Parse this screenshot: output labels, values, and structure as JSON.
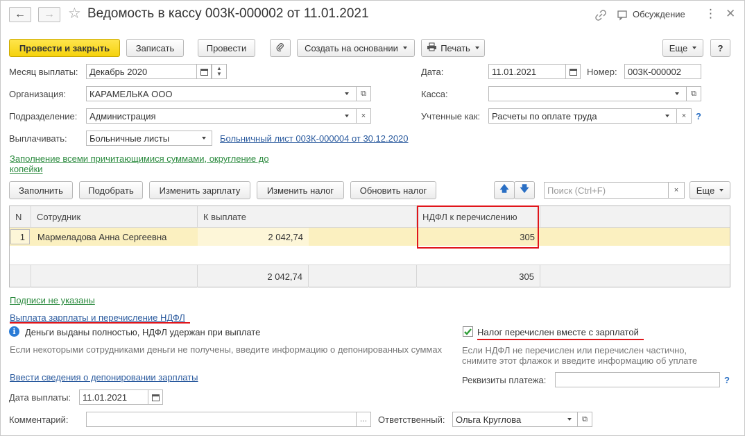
{
  "header": {
    "title": "Ведомость в кассу 003К-000002 от 11.01.2021",
    "discussion_label": "Обсуждение"
  },
  "toolbar": {
    "post_close_label": "Провести и закрыть",
    "save_label": "Записать",
    "post_label": "Провести",
    "create_based_label": "Создать на основании",
    "print_label": "Печать",
    "more_label": "Еще",
    "help_label": "?"
  },
  "form": {
    "month_label": "Месяц выплаты:",
    "month_value": "Декабрь 2020",
    "date_label": "Дата:",
    "date_value": "11.01.2021",
    "number_label": "Номер:",
    "number_value": "003К-000002",
    "org_label": "Организация:",
    "org_value": "КАРАМЕЛЬКА ООО",
    "cash_label": "Касса:",
    "cash_value": "",
    "dept_label": "Подразделение:",
    "dept_value": "Администрация",
    "account_label": "Учтенные как:",
    "account_value": "Расчеты по оплате труда",
    "pay_label": "Выплачивать:",
    "pay_value": "Больничные листы",
    "sick_link": "Больничный лист 003К-000004 от 30.12.2020",
    "fill_link_line1": "Заполнение всеми причитающимися суммами, округление до",
    "fill_link_line2": "копейки",
    "help_q": "?"
  },
  "table_toolbar": {
    "fill_label": "Заполнить",
    "pick_label": "Подобрать",
    "change_salary_label": "Изменить зарплату",
    "change_tax_label": "Изменить налог",
    "update_tax_label": "Обновить налог",
    "search_placeholder": "Поиск (Ctrl+F)",
    "more_label": "Еще"
  },
  "table": {
    "columns": [
      "N",
      "Сотрудник",
      "К выплате",
      "НДФЛ к перечислению"
    ],
    "rows": [
      {
        "n": "1",
        "employee": "Мармеладова Анна Сергеевна",
        "payout": "2 042,74",
        "tax": "305"
      }
    ],
    "totals": {
      "payout": "2 042,74",
      "tax": "305"
    }
  },
  "bottom": {
    "signatures_link": "Подписи не указаны",
    "section_title": "Выплата зарплаты и перечисление НДФЛ",
    "info_text": "Деньги выданы полностью, НДФЛ удержан при выплате",
    "hint_text": "Если некоторыми сотрудниками деньги не получены, введите информацию о депонированных суммах",
    "tax_checkbox_label": "Налог перечислен вместе с зарплатой",
    "tax_checked": true,
    "tax_hint_line1": "Если НДФЛ не перечислен или перечислен частично,",
    "tax_hint_line2": "снимите этот флажок и введите информацию об уплате",
    "deposit_link": "Ввести сведения о депонировании зарплаты",
    "payment_details_label": "Реквизиты платежа:",
    "payment_details_value": "",
    "pay_date_label": "Дата выплаты:",
    "pay_date_value": "11.01.2021",
    "comment_label": "Комментарий:",
    "comment_value": "",
    "responsible_label": "Ответственный:",
    "responsible_value": "Ольга Круглова"
  },
  "colors": {
    "accent_yellow": "#f5d20d",
    "row_highlight": "#fbf0c0",
    "green_link": "#2b8a3e",
    "blue_link": "#2a5a9e",
    "annotation_red": "#e0151a"
  }
}
